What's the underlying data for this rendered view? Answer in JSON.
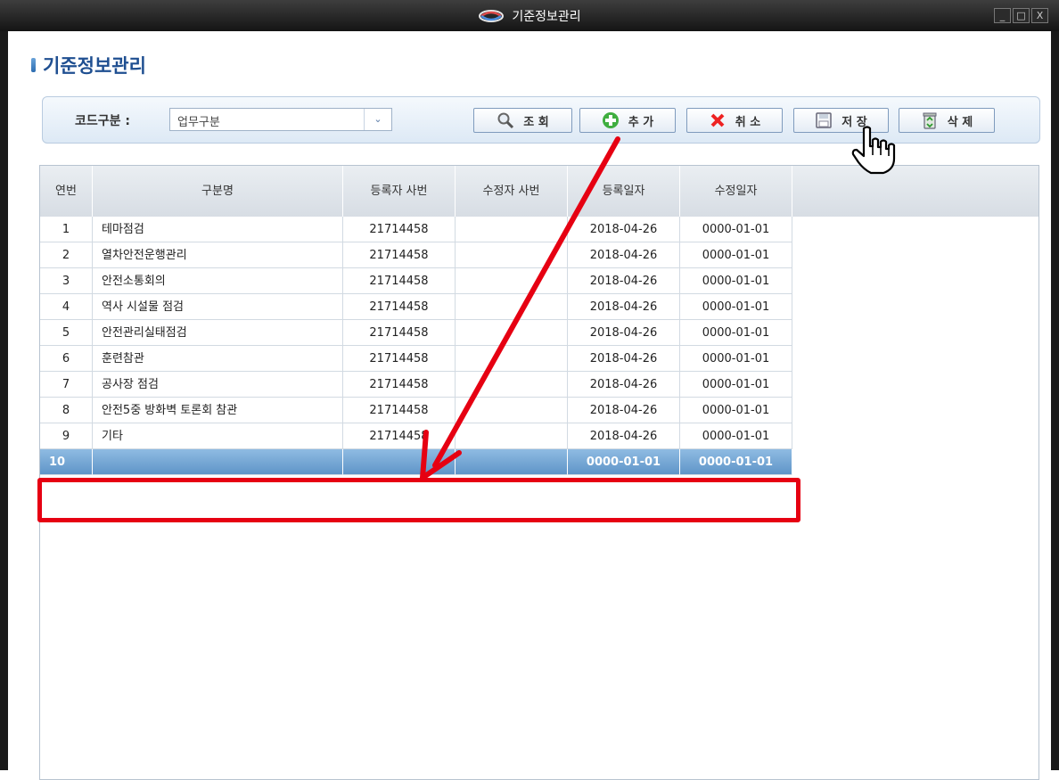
{
  "window": {
    "title": "기준정보관리",
    "minimize": "_",
    "maximize": "□",
    "close": "X"
  },
  "page": {
    "title": "기준정보관리"
  },
  "search": {
    "label": "코드구분 :",
    "select_value": "업무구분"
  },
  "toolbar": {
    "search": "조 회",
    "add": "추 가",
    "cancel": "취 소",
    "save": "저 장",
    "delete": "삭 제"
  },
  "grid": {
    "columns": [
      "연번",
      "구분명",
      "등록자 사번",
      "수정자 사번",
      "등록일자",
      "수정일자"
    ],
    "rows": [
      [
        "1",
        "테마점검",
        "21714458",
        "",
        "2018-04-26",
        "0000-01-01"
      ],
      [
        "2",
        "열차안전운행관리",
        "21714458",
        "",
        "2018-04-26",
        "0000-01-01"
      ],
      [
        "3",
        "안전소통회의",
        "21714458",
        "",
        "2018-04-26",
        "0000-01-01"
      ],
      [
        "4",
        "역사 시설물 점검",
        "21714458",
        "",
        "2018-04-26",
        "0000-01-01"
      ],
      [
        "5",
        "안전관리실태점검",
        "21714458",
        "",
        "2018-04-26",
        "0000-01-01"
      ],
      [
        "6",
        "훈련참관",
        "21714458",
        "",
        "2018-04-26",
        "0000-01-01"
      ],
      [
        "7",
        "공사장 점검",
        "21714458",
        "",
        "2018-04-26",
        "0000-01-01"
      ],
      [
        "8",
        "안전5중 방화벽 토론회 참관",
        "21714458",
        "",
        "2018-04-26",
        "0000-01-01"
      ],
      [
        "9",
        "기타",
        "21714458",
        "",
        "2018-04-26",
        "0000-01-01"
      ],
      [
        "10",
        "",
        "",
        "",
        "0000-01-01",
        "0000-01-01"
      ]
    ],
    "selected_row": 9
  },
  "colors": {
    "accent": "#1f4f91",
    "highlight": "#e60012",
    "selected_row": "#6fa3d3"
  },
  "icons": [
    "app-logo-icon",
    "magnifier-icon",
    "plus-circle-icon",
    "x-mark-icon",
    "floppy-disk-icon",
    "recycle-bin-icon",
    "hand-pointer-icon"
  ]
}
